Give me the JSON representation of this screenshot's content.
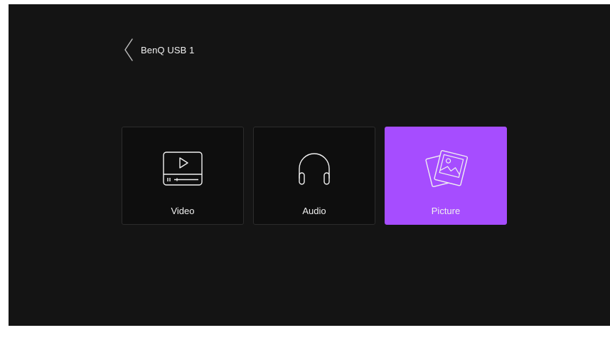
{
  "header": {
    "back_icon": "chevron-left-icon",
    "source_name": "BenQ USB 1"
  },
  "tiles": [
    {
      "label": "Video",
      "icon": "video-player-icon",
      "selected": false
    },
    {
      "label": "Audio",
      "icon": "headphones-icon",
      "selected": false
    },
    {
      "label": "Picture",
      "icon": "photos-icon",
      "selected": true
    }
  ],
  "colors": {
    "background": "#141414",
    "tile_background": "#0e0e0e",
    "tile_border": "#2c2c2c",
    "selected_accent": "#a64dff",
    "text": "#f0f0f0"
  }
}
